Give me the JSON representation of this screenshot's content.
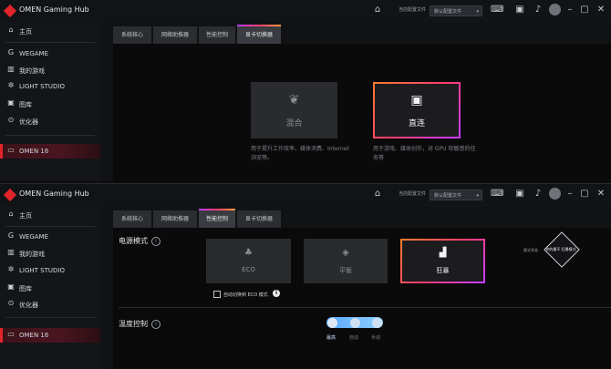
{
  "app": {
    "title": "OMEN Gaming Hub",
    "config_label": "当前配置文件",
    "config_value": "默认配置文件",
    "config_arrow": "▾",
    "icons": [
      "home-icon",
      "controller-icon",
      "window-icon",
      "bell-icon",
      "avatar",
      "minimize-icon",
      "maximize-icon",
      "close-icon"
    ]
  },
  "sidebar": {
    "items": [
      {
        "icon": "⌂",
        "label": "主页",
        "name": "home"
      },
      {
        "icon": "G",
        "label": "WEGAME",
        "name": "wegame"
      },
      {
        "icon": "▥",
        "label": "我的游戏",
        "name": "my-games"
      },
      {
        "icon": "✲",
        "label": "LIGHT STUDIO",
        "name": "light-studio"
      },
      {
        "icon": "▣",
        "label": "图库",
        "name": "gallery"
      },
      {
        "icon": "⊙",
        "label": "优化器",
        "name": "optimizer"
      }
    ],
    "device": {
      "icon": "▭",
      "label": "OMEN 16"
    }
  },
  "tabs": [
    {
      "label": "系统核心"
    },
    {
      "label": "网络助推器"
    },
    {
      "label": "性能控制"
    },
    {
      "label": "显卡切换器"
    }
  ],
  "gpu_switcher": {
    "modes": [
      {
        "icon": "🌱",
        "label": "混合",
        "desc": "用于提升工作效率、媒体消费、Internet 浏览等。"
      },
      {
        "icon": "▣",
        "label": "直连",
        "desc": "用于游戏、媒体创作，对 GPU 较敏感的任务等"
      }
    ],
    "selected": "直连"
  },
  "performance": {
    "power_title": "电源模式",
    "modes": [
      {
        "icon": "♣",
        "label": "ECO"
      },
      {
        "icon": "◈",
        "label": "平衡"
      },
      {
        "icon": "▟",
        "label": "狂暴"
      }
    ],
    "selected": "狂暴",
    "auto_eco_label": "自动切换到 ECO 模式",
    "badge_left_label": "模式状态",
    "badge_text": "你的最不 狂暴模式",
    "temp_title": "温度控制",
    "temp_levels": [
      "最高",
      "自动",
      "手动"
    ],
    "temp_selected": "最高",
    "colors": {
      "accent_from": "#ff7b2e",
      "accent_to": "#c43cff",
      "slider": "#5aa8ff",
      "brand_red": "#e0262a"
    }
  }
}
